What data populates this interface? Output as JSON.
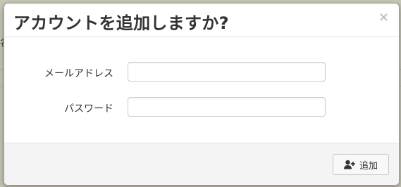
{
  "dialog": {
    "title": "アカウントを追加しますか?",
    "close_label": "×",
    "fields": {
      "email": {
        "label": "メールアドレス",
        "value": "",
        "placeholder": ""
      },
      "password": {
        "label": "パスワード",
        "value": "",
        "placeholder": ""
      }
    },
    "add_button": {
      "label": "追加",
      "icon": "user-plus-icon"
    }
  },
  "backdrop": {
    "partial_glyph": "名"
  },
  "colors": {
    "backdrop": "#c9c7b5",
    "footer": "#f4f4f4",
    "title": "#333333",
    "close": "#c0c0c0"
  }
}
